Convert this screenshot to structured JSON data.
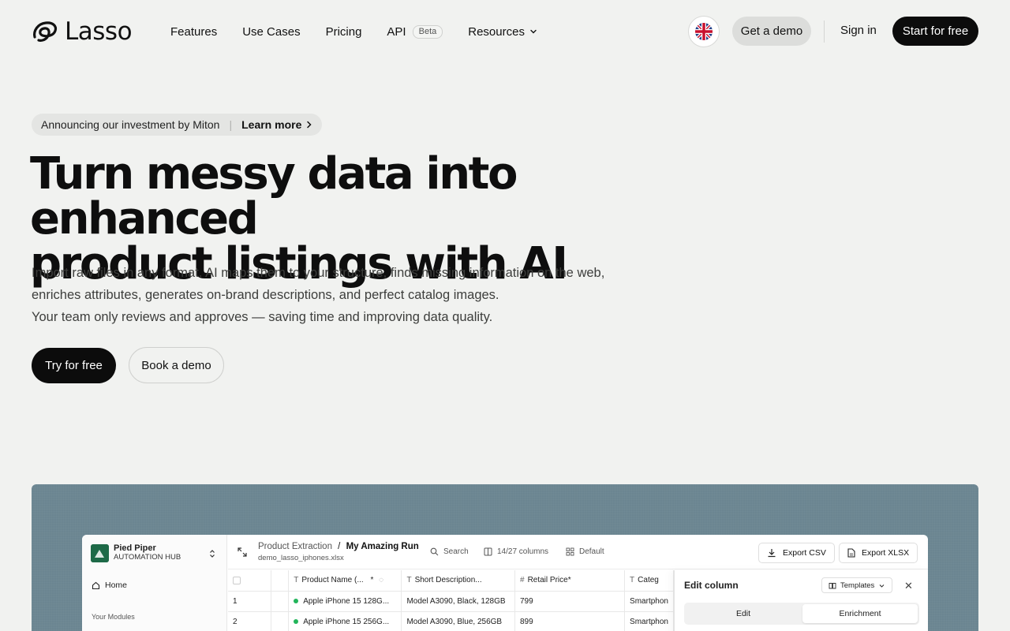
{
  "brand": {
    "name": "Lasso"
  },
  "nav": {
    "links": [
      {
        "label": "Features"
      },
      {
        "label": "Use Cases"
      },
      {
        "label": "Pricing"
      },
      {
        "label": "API",
        "badge": "Beta"
      },
      {
        "label": "Resources",
        "has_dropdown": true
      }
    ],
    "language_icon": "uk-flag-icon",
    "get_demo": "Get a demo",
    "sign_in": "Sign in",
    "start_free": "Start for free"
  },
  "hero": {
    "announcement": {
      "text": "Announcing our investment by Miton",
      "link": "Learn more"
    },
    "title_line1": "Turn messy data into enhanced",
    "title_line2": "product listings with AI",
    "subtitle_lines": [
      "Import raw files in any format. AI maps them to your structure, finds missing information on the web,",
      "enriches attributes, generates on-brand descriptions, and perfect catalog images.",
      "Your team only reviews and approves — saving time and improving data quality."
    ],
    "cta_primary": "Try for free",
    "cta_secondary": "Book a demo"
  },
  "app_preview": {
    "workspace": {
      "name": "Pied Piper",
      "sub": "AUTOMATION HUB"
    },
    "sidebar": {
      "home": "Home",
      "modules_heading": "Your Modules"
    },
    "breadcrumb": {
      "parent": "Product Extraction",
      "separator": "/",
      "current": "My Amazing Run"
    },
    "file": "demo_lasso_iphones.xlsx",
    "toolbar": {
      "search": "Search",
      "columns": "14/27 columns",
      "view": "Default",
      "export_csv": "Export CSV",
      "export_xlsx": "Export XLSX"
    },
    "table": {
      "headers": [
        "Product Name (...",
        "Short Description...",
        "Retail Price",
        "Categ"
      ],
      "rows": [
        {
          "index": "1",
          "name": "Apple iPhone 15 128G...",
          "desc": "Model A3090, Black, 128GB",
          "price": "799",
          "category": "Smartphon"
        },
        {
          "index": "2",
          "name": "Apple iPhone 15 256G...",
          "desc": "Model A3090, Blue, 256GB",
          "price": "899",
          "category": "Smartphon"
        }
      ]
    },
    "panel": {
      "title": "Edit column",
      "templates": "Templates",
      "tab_edit": "Edit",
      "tab_enrichment": "Enrichment"
    }
  }
}
